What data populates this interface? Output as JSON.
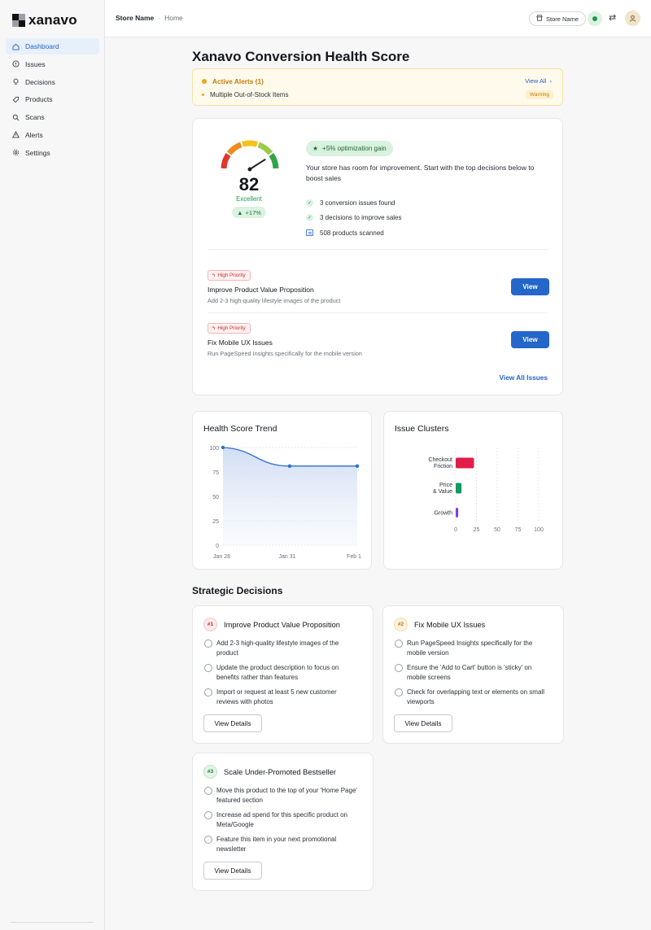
{
  "brand": {
    "name": "xanavo"
  },
  "sidebar": {
    "items": [
      {
        "label": "Dashboard",
        "icon": "home-icon",
        "active": true
      },
      {
        "label": "Issues",
        "icon": "alert-circle-icon"
      },
      {
        "label": "Decisions",
        "icon": "lightbulb-icon"
      },
      {
        "label": "Products",
        "icon": "tag-icon"
      },
      {
        "label": "Scans",
        "icon": "search-icon"
      },
      {
        "label": "Alerts",
        "icon": "warning-triangle-icon"
      },
      {
        "label": "Settings",
        "icon": "gear-icon"
      }
    ]
  },
  "topbar": {
    "store_name": "Store Name",
    "separator": "·",
    "page": "Home",
    "store_pill": "Store Name"
  },
  "page": {
    "title": "Xanavo Conversion Health Score"
  },
  "alerts": {
    "heading": "Active Alerts (1)",
    "view_all": "View All",
    "item": "Multiple Out-of-Stock Items",
    "badge": "Warning"
  },
  "score": {
    "value": "82",
    "label": "Excellent",
    "delta": "+17%",
    "gain": "+5% optimization gain",
    "description": "Your store has room for improvement. Start with the top decisions below to boost sales",
    "stats": [
      "3 conversion issues found",
      "3 decisions to improve sales",
      "508 products scanned"
    ],
    "gauge_fraction": 0.82
  },
  "issues": [
    {
      "priority": "High Priority",
      "title": "Improve Product Value Proposition",
      "subtitle": "Add 2-3 high-quality lifestyle images of the product",
      "button": "View"
    },
    {
      "priority": "High Priority",
      "title": "Fix Mobile UX Issues",
      "subtitle": "Run PageSpeed Insights specifically for the mobile version",
      "button": "View"
    }
  ],
  "view_all_issues": "View All Issues",
  "charts": {
    "trend_title": "Health Score Trend",
    "clusters_title": "Issue Clusters"
  },
  "chart_data": [
    {
      "type": "area",
      "title": "Health Score Trend",
      "x": [
        "Jan 28",
        "Jan 31",
        "Feb 1"
      ],
      "values": [
        100,
        81,
        81
      ],
      "y_ticks": [
        100,
        75,
        50,
        25,
        0
      ],
      "ylim": [
        0,
        100
      ],
      "grid": true,
      "color": "#2f6fd0"
    },
    {
      "type": "bar",
      "orientation": "horizontal",
      "title": "Issue Clusters",
      "categories": [
        "Checkout Friction",
        "Price & Value",
        "Growth"
      ],
      "values": [
        22,
        7,
        3
      ],
      "colors": [
        "#e11d48",
        "#129a63",
        "#7c3aed"
      ],
      "x_ticks": [
        0,
        25,
        50,
        75,
        100
      ],
      "xlim": [
        0,
        100
      ],
      "grid": true
    }
  ],
  "strategic": {
    "title": "Strategic Decisions",
    "decisions": [
      {
        "rank": "#1",
        "title": "Improve Product Value Proposition",
        "steps": [
          "Add 2-3 high-quality lifestyle images of the product",
          "Update the product description to focus on benefits rather than features",
          "Import or request at least 5 new customer reviews with photos"
        ],
        "button": "View Details"
      },
      {
        "rank": "#2",
        "title": "Fix Mobile UX Issues",
        "steps": [
          "Run PageSpeed Insights specifically for the mobile version",
          "Ensure the 'Add to Cart' button is 'sticky' on mobile screens",
          "Check for overlapping text or elements on small viewports"
        ],
        "button": "View Details"
      },
      {
        "rank": "#3",
        "title": "Scale Under-Promoted Bestseller",
        "steps": [
          "Move this product to the top of your 'Home Page' featured section",
          "Increase ad spend for this specific product on Meta/Google",
          "Feature this item in your next promotional newsletter"
        ],
        "button": "View Details"
      }
    ]
  }
}
